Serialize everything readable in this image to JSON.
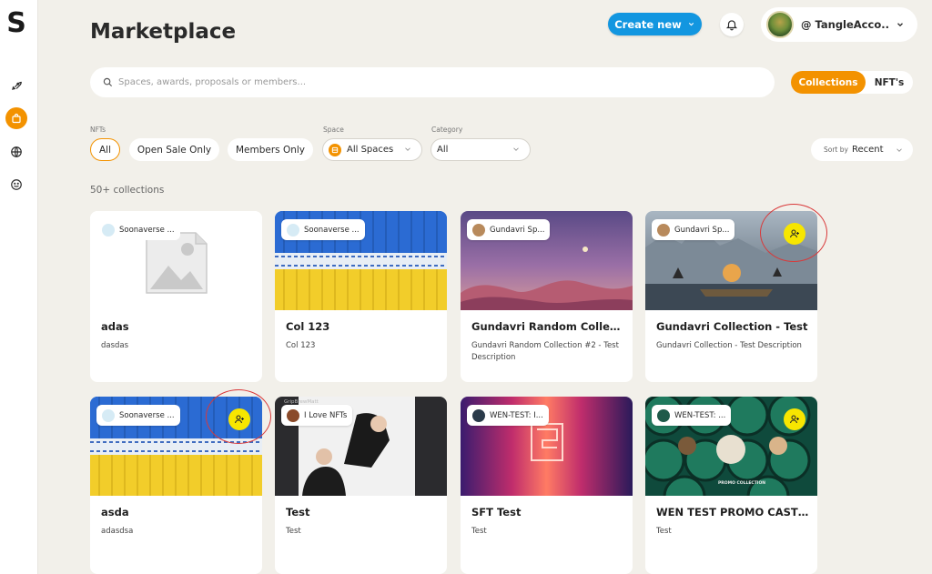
{
  "app": {
    "logo": "S"
  },
  "sidebar": {
    "items": [
      {
        "icon": "rocket-icon"
      },
      {
        "icon": "bag-icon",
        "active": true
      },
      {
        "icon": "globe-icon"
      },
      {
        "icon": "smile-icon"
      }
    ]
  },
  "header": {
    "title": "Marketplace",
    "create_label": "Create new",
    "account_name": "@ TangleAcco..."
  },
  "search": {
    "placeholder": "Spaces, awards, proposals or members..."
  },
  "view_toggle": {
    "active": "Collections",
    "inactive": "NFT's"
  },
  "filters": {
    "nfts_label": "NFTs",
    "nft_options": [
      "All",
      "Open Sale Only",
      "Members Only"
    ],
    "space_label": "Space",
    "space_value": "All Spaces",
    "category_label": "Category",
    "category_value": "All",
    "sort_prefix": "Sort by",
    "sort_value": "Recent"
  },
  "results": {
    "count_text": "50+ collections"
  },
  "accent_color": "#f39200",
  "primary_color": "#1296e0",
  "collections": [
    {
      "space": "Soonaverse ...",
      "title": "adas",
      "description": "dasdas"
    },
    {
      "space": "Soonaverse ...",
      "title": "Col 123",
      "description": "Col 123"
    },
    {
      "space": "Gundavri Sp...",
      "title": "Gundavri Random Collecti...",
      "description": "Gundavri Random Collection #2 - Test Description"
    },
    {
      "space": "Gundavri Sp...",
      "title": "Gundavri Collection - Test",
      "description": "Gundavri Collection - Test Description",
      "joinable": true
    },
    {
      "space": "Soonaverse ...",
      "title": "asda",
      "description": "adasdsa",
      "joinable": true
    },
    {
      "space": "I Love NFTs",
      "title": "Test",
      "description": "Test",
      "overlay_text": "GripBrewMatt"
    },
    {
      "space": "WEN-TEST: I...",
      "title": "SFT Test",
      "description": "Test"
    },
    {
      "space": "WEN-TEST: ...",
      "title": "WEN TEST PROMO CASTERS",
      "description": "Test",
      "joinable": true,
      "overlay_text": "PROMO COLLECTION"
    }
  ]
}
